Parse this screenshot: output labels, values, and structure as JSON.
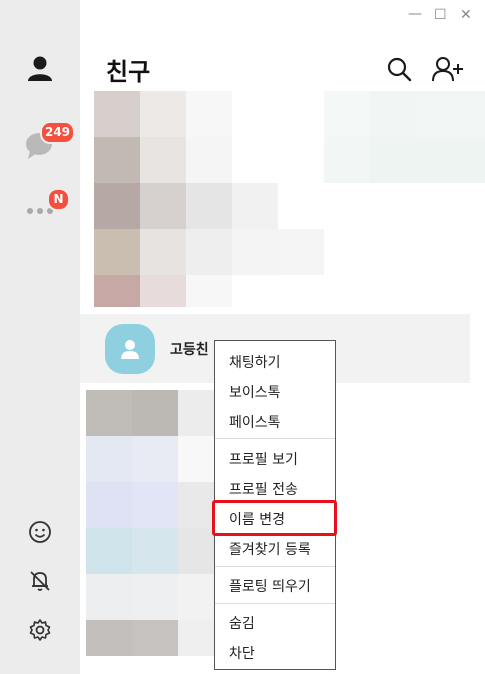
{
  "window": {
    "minimize": "—",
    "maximize": "☐",
    "close": "✕"
  },
  "sidebar": {
    "chat_badge": "249",
    "more_badge": "N"
  },
  "header": {
    "title": "친구"
  },
  "friend": {
    "name": "고등친"
  },
  "context_menu": {
    "items": [
      "채팅하기",
      "보이스톡",
      "페이스톡",
      "프로필 보기",
      "프로필 전송",
      "이름 변경",
      "즐겨찾기 등록",
      "플로팅 띄우기",
      "숨김",
      "차단"
    ],
    "highlighted": "이름 변경",
    "highlight_color": "#e8101a"
  },
  "colors": {
    "sidebar_bg": "#ececec",
    "badge": "#f4503d",
    "avatar": "#8ed0e0"
  }
}
